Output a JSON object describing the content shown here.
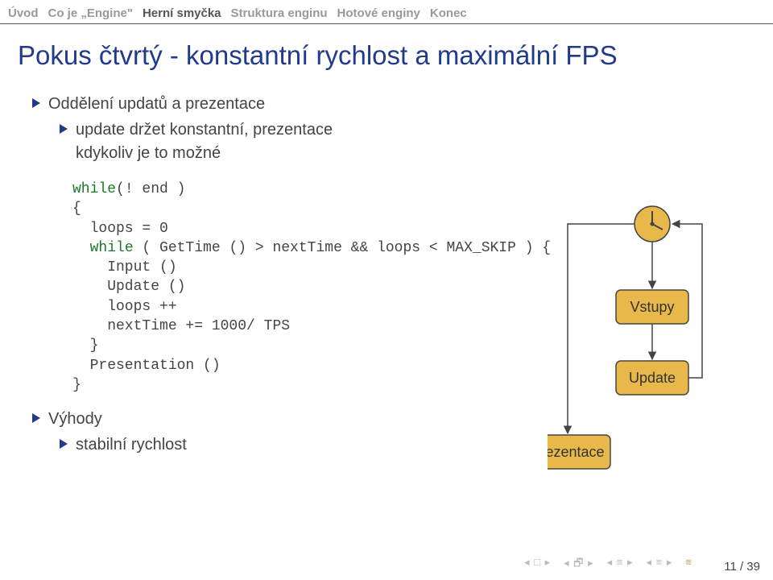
{
  "nav": {
    "items": [
      "Úvod",
      "Co je „Engine\"",
      "Herní smyčka",
      "Struktura enginu",
      "Hotové enginy",
      "Konec"
    ],
    "active_index": 2
  },
  "title": "Pokus čtvrtý - konstantní rychlost a maximální FPS",
  "bullets": {
    "b1": "Oddělení updatů a prezentace",
    "b1a": "update držet konstantní, prezentace",
    "b1b": "kdykoliv je to možné",
    "b2": "Výhody",
    "b2a": "stabilní rychlost"
  },
  "code": {
    "l1a": "while",
    "l1b": "(! end )",
    "l2": "{",
    "l3": "  loops = 0",
    "l4a": "  ",
    "l4b": "while",
    "l4c": " ( GetTime () > nextTime && loops < MAX_SKIP ) {",
    "l5": "    Input ()",
    "l6": "    Update ()",
    "l7": "    loops ++",
    "l8": "    nextTime += 1000/ TPS",
    "l9": "  }",
    "l10": "  Presentation ()",
    "l11": "}"
  },
  "diagram": {
    "vstupy": "Vstupy",
    "update": "Update",
    "prezentace": "Prezentace"
  },
  "page": "11 / 39",
  "footer_icons": {
    "a": "◂ □ ▸",
    "b": "◂ 🗗 ▸",
    "c": "◂ ≡ ▸",
    "d": "◂ ≡ ▸",
    "e": "≡"
  }
}
